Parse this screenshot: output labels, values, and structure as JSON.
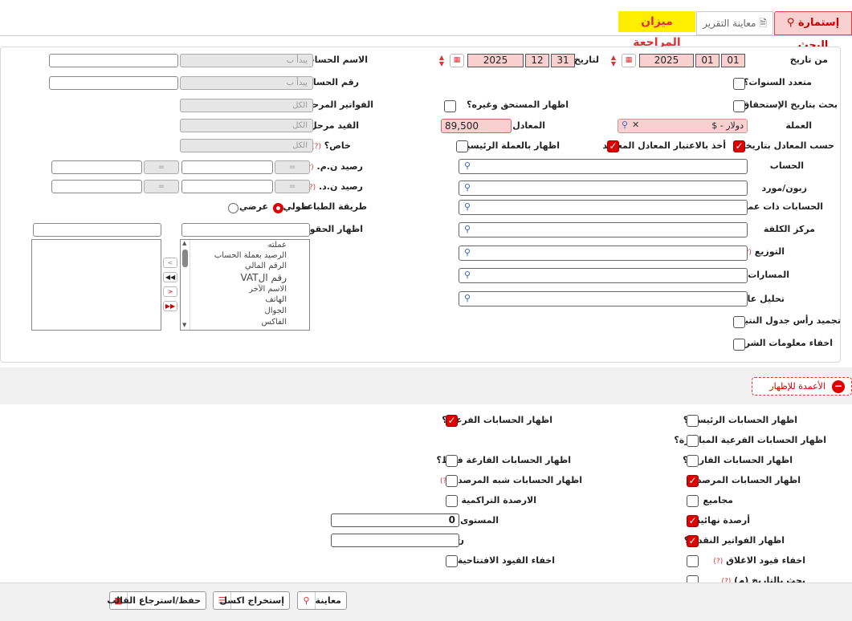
{
  "tabs": {
    "search_form": "إستمارة البحث",
    "report_preview": "معاينة التقرير",
    "page_title": "ميزان المراجعة"
  },
  "dates": {
    "from_label": "من تاريخ",
    "from_day": "01",
    "from_month": "01",
    "from_year": "2025",
    "to_label": "لتاريخ",
    "to_day": "31",
    "to_month": "12",
    "to_year": "2025"
  },
  "right_col": {
    "multi_years": "متعدد السنوات؟",
    "search_due_date": "بحث بتاريخ الإستحقاق؟",
    "show_due_etc": "اظهار المستحق وغيره؟",
    "currency_label": "العملة",
    "currency_value": "دولار - $",
    "rate_label": "المعادل",
    "rate_value": "89,500",
    "rate_by_date": "حسب المعادل بتاريخه؟",
    "consider_rate": "أخذ بالاعتبار المعادل المعتمد",
    "show_main_currency": "اظهار بالعملة الرئيسية؟",
    "account": "الحساب",
    "customer_supplier": "زبون/مورد",
    "currency_accounts": "الحسابات ذات عملة",
    "cost_center": "مركز الكلفة",
    "distribution": "التوزيع",
    "tracks": "المسارات",
    "general_analysis": "تحليل عام",
    "freeze_header": "تجميد رأس جدول النتيجة",
    "hide_company_info": "اخفاء معلومات الشركة"
  },
  "left_col": {
    "account_name": "الاسم الحساب",
    "account_number": "رقم الحساب",
    "starts_with": "يبدأ ب",
    "transferred_invoices": "الفواتير المرحلة؟",
    "transferred_entry": "القيد مرحل؟",
    "private": "خاص؟",
    "all": "الكل",
    "balance_nm": "رصيد ن.م.",
    "balance_nd": "رصيد ن.د.",
    "eq": "=",
    "print_method": "طريقة الطباعة",
    "portrait": "طولي",
    "landscape": "عرضي",
    "show_fields": "اظهار الحقول",
    "field_items": [
      "عملته",
      "الرصيد بعملة الحساب",
      "الرقم المالي",
      "رقم الVAT",
      "الاسم الآخر",
      "الهاتف",
      "الجوال",
      "الفاكس"
    ]
  },
  "columns_button": "الأعمدة للإظهار",
  "options": {
    "show_main_accounts": "اظهار الحسابات الرئيسية؟",
    "show_sub_accounts": "اظهار الحسابات الفرعية؟",
    "show_direct_sub": "اظهار الحسابات الفرعية المباشرة؟",
    "show_empty_accounts": "اظهار الحسابات الفارغة؟",
    "show_empty_only": "اظهار الحسابات الفارغة فقط؟",
    "show_balanced": "اظهار الحسابات المرصدة؟",
    "show_semi_balanced": "اظهار الحسابات شبه المرصدة",
    "totals": "مجاميع",
    "cumulative_balances": "الارصدة التراكمية",
    "final_balances": "أرصدة نهائية",
    "level_label": "المستوى",
    "level_value": "0",
    "n_label": "ن.",
    "show_cash_invoices": "اظهار الفواتير النقدية؟",
    "hide_closing_entries": "اخفاء قيود الاغلاق",
    "hide_opening_entries": "اخفاء القيود الافتتاحية",
    "search_by_date": "بحث بالتاريخ (م)"
  },
  "buttons": {
    "preview": "معاينة",
    "export_excel": "إستخراج اكسل",
    "save_template": "حفظ/استرجاع القالب"
  },
  "colors": {
    "accent": "#dd0000",
    "pink_field": "#f9d0d0",
    "title_bg": "#ffee00"
  }
}
